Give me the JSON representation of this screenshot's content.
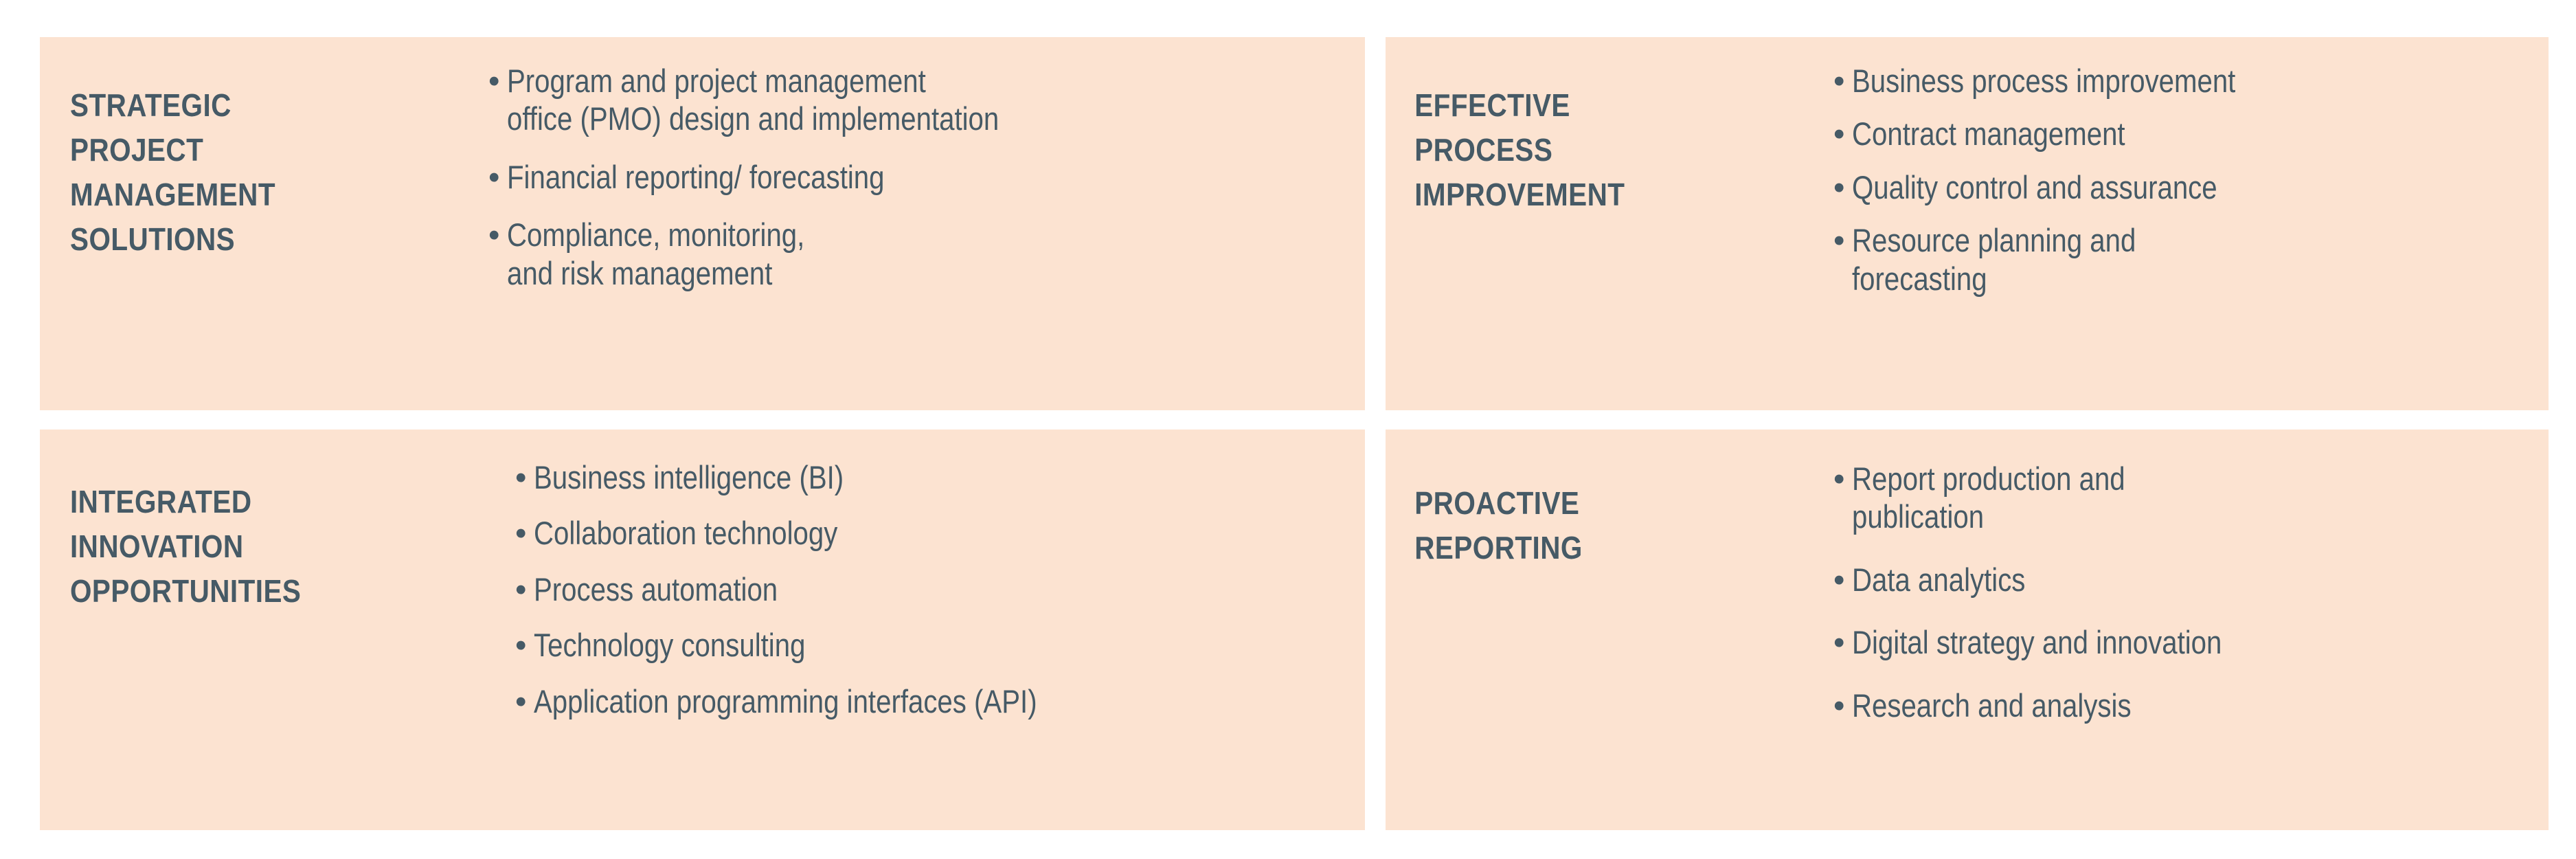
{
  "colors": {
    "page_background": "#FFFFFF",
    "panel_background": "#FCE3D1",
    "text": "#465A66"
  },
  "bullet_glyph": "•",
  "panels": [
    {
      "id": "strategic-project-management-solutions",
      "heading_lines": [
        "STRATEGIC",
        "PROJECT",
        "MANAGEMENT",
        "SOLUTIONS"
      ],
      "heading_text": "STRATEGIC PROJECT MANAGEMENT SOLUTIONS",
      "bullets": [
        "Program and project management\noffice (PMO) design and implementation",
        "Financial reporting/ forecasting",
        "Compliance, monitoring,\nand risk management"
      ]
    },
    {
      "id": "effective-process-improvement",
      "heading_lines": [
        "EFFECTIVE",
        "PROCESS",
        "IMPROVEMENT"
      ],
      "heading_text": "EFFECTIVE PROCESS IMPROVEMENT",
      "bullets": [
        "Business process improvement",
        "Contract management",
        "Quality control and assurance",
        "Resource planning and\nforecasting"
      ]
    },
    {
      "id": "integrated-innovation-opportunities",
      "heading_lines": [
        "INTEGRATED",
        "INNOVATION",
        "OPPORTUNITIES"
      ],
      "heading_text": "INTEGRATED INNOVATION OPPORTUNITIES",
      "bullets": [
        "Business intelligence (BI)",
        "Collaboration technology",
        "Process automation",
        "Technology consulting",
        "Application programming interfaces (API)"
      ]
    },
    {
      "id": "proactive-reporting",
      "heading_lines": [
        "PROACTIVE",
        "REPORTING"
      ],
      "heading_text": "PROACTIVE REPORTING",
      "bullets": [
        "Report production and\npublication",
        "Data analytics",
        "Digital strategy and innovation",
        "Research and analysis"
      ]
    }
  ]
}
